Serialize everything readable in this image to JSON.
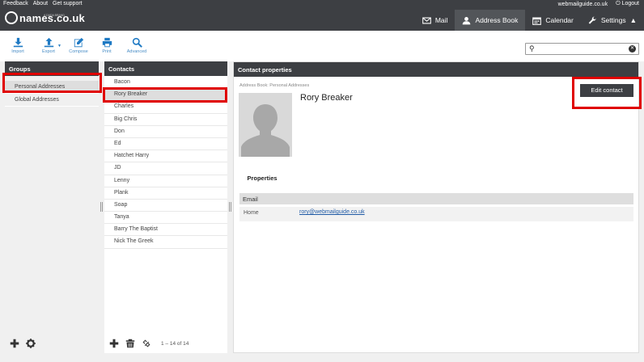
{
  "topbar": {
    "links": [
      "Feedback",
      "About",
      "Get support"
    ],
    "account": "webmailguide.co.uk",
    "logout": "Logout"
  },
  "logo": {
    "text": "names.co.uk",
    "sub": "A DADA BRAND"
  },
  "nav": {
    "tabs": [
      {
        "label": "Mail",
        "icon": "mail-icon"
      },
      {
        "label": "Address Book",
        "icon": "person-icon"
      },
      {
        "label": "Calendar",
        "icon": "calendar-icon"
      },
      {
        "label": "Settings",
        "icon": "wrench-icon"
      }
    ],
    "active": "Address Book"
  },
  "toolbar": {
    "import": "Import",
    "export": "Export",
    "compose": "Compose",
    "print": "Print",
    "advanced": "Advanced"
  },
  "search": {
    "placeholder": "",
    "value": ""
  },
  "groups": {
    "title": "Groups",
    "items": [
      "Personal Addresses",
      "Global Addresses"
    ],
    "selected": "Personal Addresses"
  },
  "contacts": {
    "title": "Contacts",
    "items": [
      "Bacon",
      "Rory Breaker",
      "Charles",
      "Big Chris",
      "Don",
      "Ed",
      "Hatchet Harry",
      "JD",
      "Lenny",
      "Plank",
      "Soap",
      "Tanya",
      "Barry The Baptist",
      "Nick The Greek"
    ],
    "selected": "Rory Breaker",
    "count": "1 – 14 of 14"
  },
  "contact_properties": {
    "title": "Contact properties",
    "address_book": "Address Book: Personal Addresses",
    "name": "Rory Breaker",
    "edit_button": "Edit contact",
    "tab": "Properties",
    "section": "Email",
    "email_label": "Home",
    "email_value": "rory@webmailguide.co.uk"
  },
  "colors": {
    "header": "#3d3f43",
    "accent": "#1f7ac4",
    "highlight": "#e00000"
  }
}
